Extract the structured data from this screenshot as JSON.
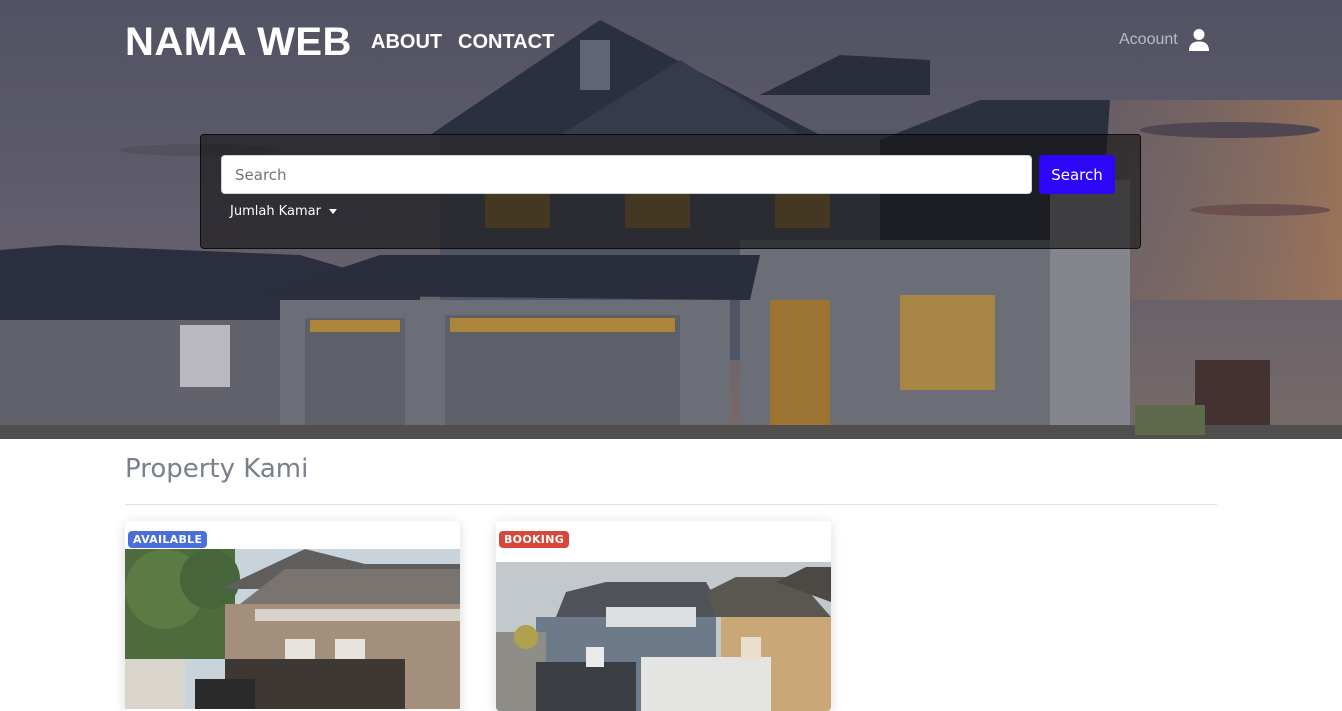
{
  "nav": {
    "brand": "NAMA WEB",
    "about": "ABOUT",
    "contact": "CONTACT",
    "account": "Acoount"
  },
  "search": {
    "placeholder": "Search",
    "button_label": "Search",
    "dropdown_label": "Jumlah Kamar"
  },
  "section": {
    "title": "Property Kami"
  },
  "properties": [
    {
      "status": "AVAILABLE",
      "status_color": "#4a6fdc"
    },
    {
      "status": "BOOKING",
      "status_color": "#d9473b"
    }
  ],
  "colors": {
    "accent": "#2d05f7",
    "section_title": "#7a7f8c"
  }
}
